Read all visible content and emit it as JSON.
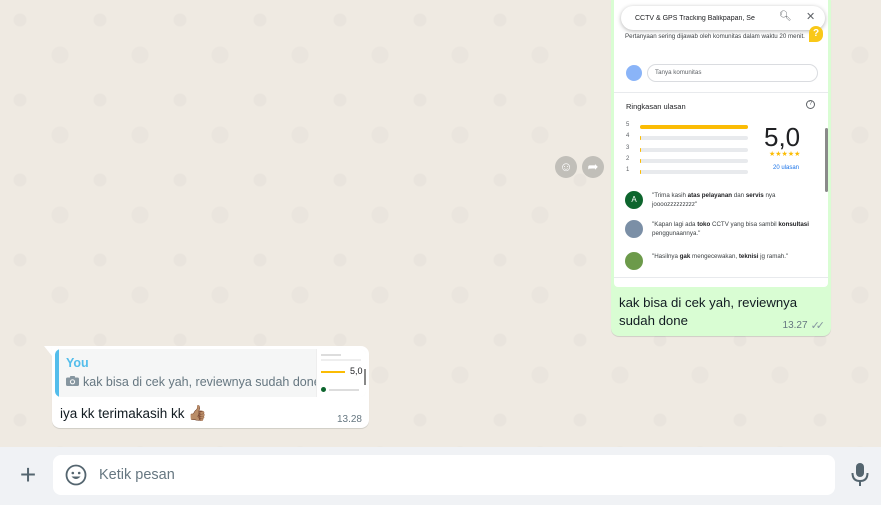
{
  "colors": {
    "chat_bg": "#efeae2",
    "outgoing_bubble": "#d9fdd3",
    "incoming_bubble": "#ffffff",
    "quote_accent": "#53bdeb",
    "star": "#fbbc04",
    "footer_bg": "#f0f2f5"
  },
  "outgoing_message": {
    "image": {
      "search_query": "CCTV & GPS Tracking Balikpapan, Se",
      "qa_text": "Pertanyaan sering dijawab oleh komunitas dalam waktu 20 menit.",
      "qa_icon": "?",
      "ask_placeholder": "Tanya komunitas",
      "summary_title": "Ringkasan ulasan",
      "help_icon": "?",
      "rating_bars": [
        {
          "label": "5",
          "fraction": 1.0
        },
        {
          "label": "4",
          "fraction": 0.0
        },
        {
          "label": "3",
          "fraction": 0.0
        },
        {
          "label": "2",
          "fraction": 0.0
        },
        {
          "label": "1",
          "fraction": 0.0
        }
      ],
      "rating_value": "5,0",
      "stars": "★★★★★",
      "review_count": "20 ulasan",
      "reviews": [
        {
          "avatar": "A",
          "avatar_color": "#0d652d",
          "pre": "\"Trima kasih ",
          "b1": "atas pelayanan",
          "mid": " dan ",
          "b2": "servis",
          "post": " nya joooozzzzzzzzz\""
        },
        {
          "avatar": "",
          "avatar_color": "#7b8fa6",
          "pre": "\"Kapan lagi ada ",
          "b1": "toko",
          "mid": " CCTV yang bisa sambil ",
          "b2": "konsultasi",
          "post": " penggunaannya.\""
        },
        {
          "avatar": "",
          "avatar_color": "#6c9a4a",
          "pre": "\"Hasilnya ",
          "b1": "gak",
          "mid": " mengecewakan, ",
          "b2": "teknisi",
          "post": " jg ramah.\""
        }
      ]
    },
    "caption": "kak bisa di cek yah, reviewnya sudah done",
    "time": "13.27",
    "ticks": "✓✓"
  },
  "incoming_message": {
    "quote_author": "You",
    "quote_text": "kak bisa di cek yah, reviewnya sudah done",
    "thumb_rating": "5,0",
    "text": "iya kk terimakasih kk",
    "emoji": "👍🏽",
    "time": "13.28"
  },
  "composer": {
    "plus_label": "+",
    "placeholder": "Ketik pesan"
  }
}
